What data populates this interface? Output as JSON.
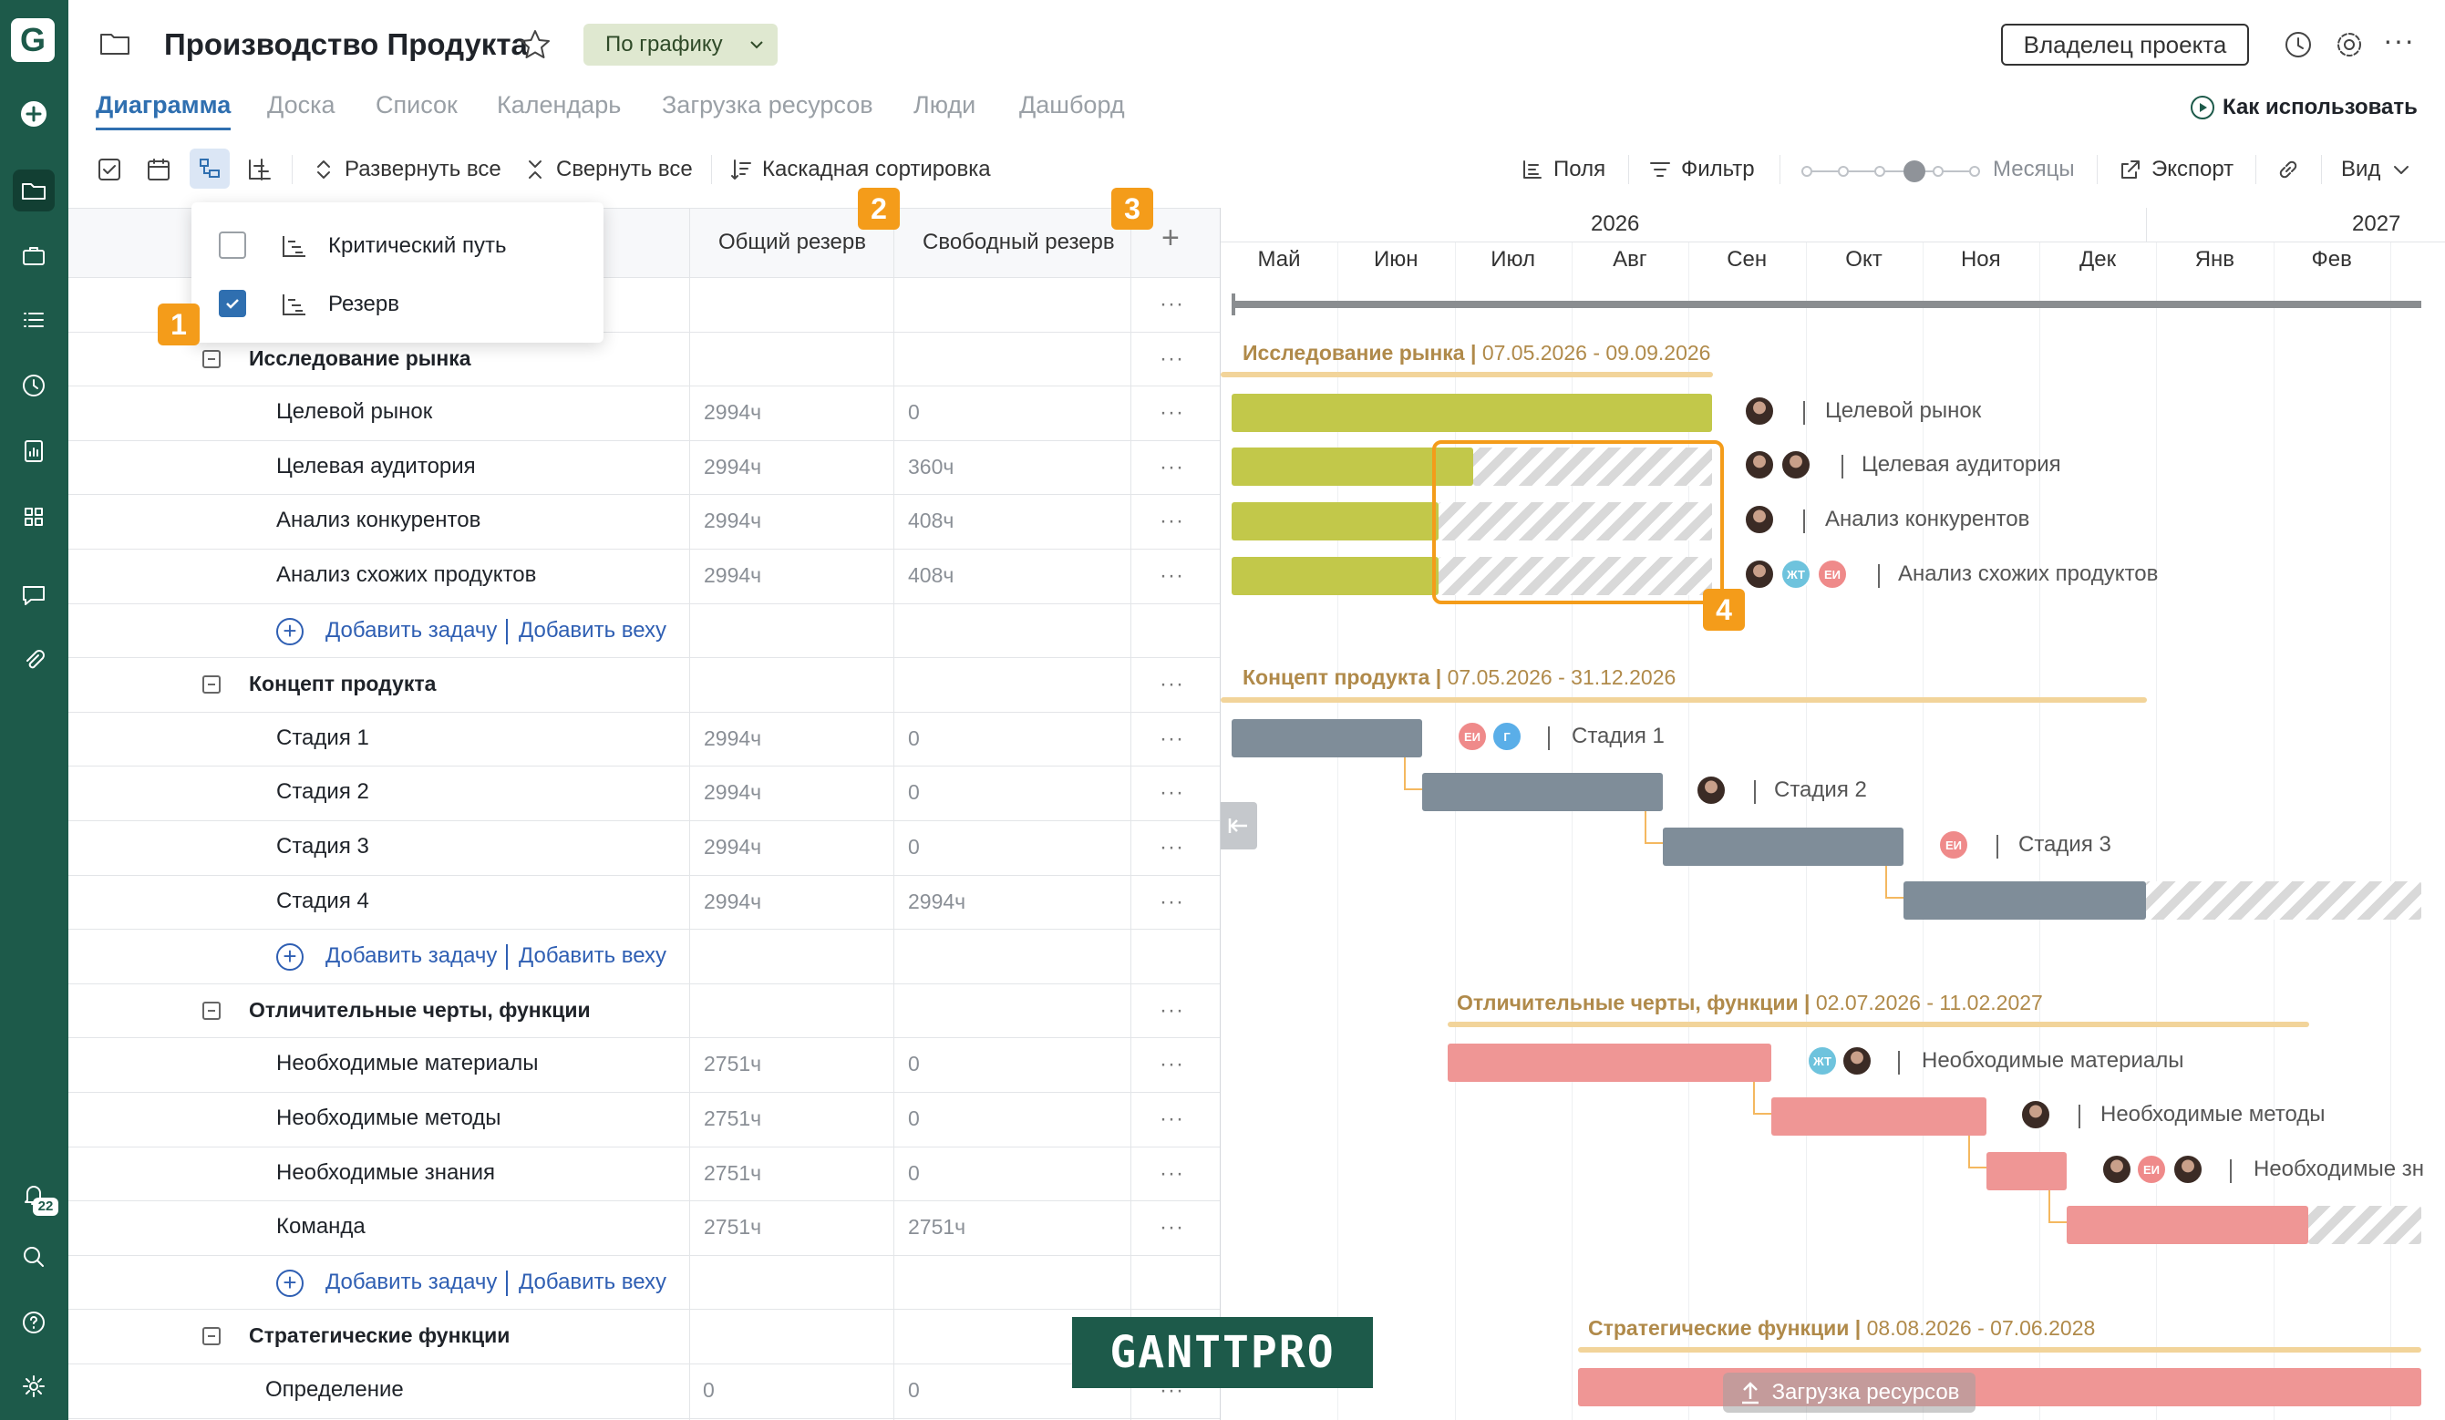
{
  "app": {
    "project_title": "Производство Продукта",
    "status_pill": "По графику",
    "owner_button": "Владелец проекта",
    "how_to_use": "Как использовать"
  },
  "tabs": [
    "Диаграмма",
    "Доска",
    "Список",
    "Календарь",
    "Загрузка ресурсов",
    "Люди",
    "Дашборд"
  ],
  "toolbar": {
    "expand_all": "Развернуть все",
    "collapse_all": "Свернуть все",
    "cascade_sort": "Каскадная сортировка",
    "fields": "Поля",
    "filter": "Фильтр",
    "months": "Месяцы",
    "export": "Экспорт",
    "view": "Вид"
  },
  "dropdown": {
    "critical_path": "Критический путь",
    "slack": "Резерв",
    "critical_checked": false,
    "slack_checked": true
  },
  "columns": {
    "total_slack": "Общий резерв",
    "free_slack": "Свободный резерв"
  },
  "badges": [
    "1",
    "2",
    "3",
    "4"
  ],
  "groups": [
    {
      "name": "Исследование рынка",
      "range": "07.05.2026 - 09.09.2026",
      "tasks": [
        {
          "name": "Целевой рынок",
          "total": "2994ч",
          "free": "0"
        },
        {
          "name": "Целевая аудитория",
          "total": "2994ч",
          "free": "360ч"
        },
        {
          "name": "Анализ конкурентов",
          "total": "2994ч",
          "free": "408ч"
        },
        {
          "name": "Анализ схожих продуктов",
          "total": "2994ч",
          "free": "408ч"
        }
      ]
    },
    {
      "name": "Концепт продукта",
      "range": "07.05.2026 - 31.12.2026",
      "tasks": [
        {
          "name": "Стадия 1",
          "total": "2994ч",
          "free": "0"
        },
        {
          "name": "Стадия 2",
          "total": "2994ч",
          "free": "0"
        },
        {
          "name": "Стадия 3",
          "total": "2994ч",
          "free": "0"
        },
        {
          "name": "Стадия 4",
          "total": "2994ч",
          "free": "2994ч"
        }
      ]
    },
    {
      "name": "Отличительные черты, функции",
      "range": "02.07.2026 - 11.02.2027",
      "tasks": [
        {
          "name": "Необходимые материалы",
          "total": "2751ч",
          "free": "0"
        },
        {
          "name": "Необходимые методы",
          "total": "2751ч",
          "free": "0"
        },
        {
          "name": "Необходимые знания",
          "total": "2751ч",
          "free": "0"
        },
        {
          "name": "Команда",
          "total": "2751ч",
          "free": "2751ч"
        }
      ]
    },
    {
      "name": "Стратегические функции",
      "range": "08.08.2026 - 07.06.2028",
      "tasks": [
        {
          "name": "Определение",
          "total": "0",
          "free": "0"
        }
      ]
    }
  ],
  "add_task": "Добавить задачу",
  "add_milestone": "Добавить веху",
  "timeline": {
    "years": [
      "2026",
      "2027"
    ],
    "months": [
      "Май",
      "Июн",
      "Июл",
      "Авг",
      "Сен",
      "Окт",
      "Ноя",
      "Дек",
      "Янв",
      "Фев"
    ]
  },
  "gantt_labels": {
    "needed_knowledge": "Необходимые зн"
  },
  "avatars": {
    "zht": "ЖТ",
    "ei": "ЕИ",
    "g": "Г"
  },
  "watermark": "GANTTPRO",
  "resource_load": "Загрузка ресурсов",
  "notification_count": "22",
  "colors": {
    "sidebar": "#1d5a4a",
    "accent": "#2f6fb0",
    "green_bar": "#c2c84a",
    "gray_bar": "#7f8d99",
    "pink_bar": "#ef9695",
    "badge": "#f49c1a"
  }
}
